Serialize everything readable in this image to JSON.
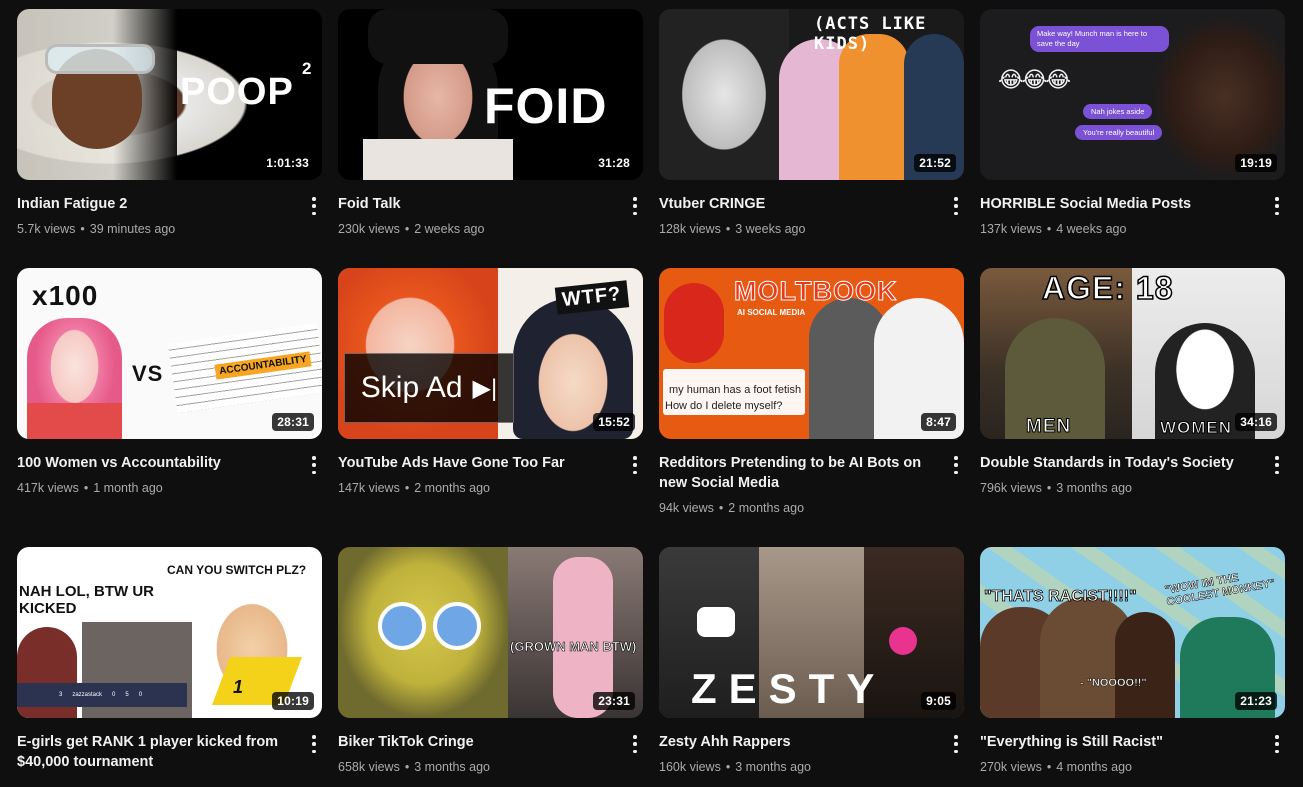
{
  "colors": {
    "background": "#0f0f0f",
    "title": "#f1f1f1",
    "subtitle": "#aaaaaa"
  },
  "videos": [
    {
      "title": "Indian Fatigue 2",
      "views": "5.7k views",
      "age": "39 minutes ago",
      "duration": "1:01:33",
      "overlay": "POOP",
      "overlay_sup": "2"
    },
    {
      "title": "Foid Talk",
      "views": "230k views",
      "age": "2 weeks ago",
      "duration": "31:28",
      "overlay": "FOID"
    },
    {
      "title": "Vtuber CRINGE",
      "views": "128k views",
      "age": "3 weeks ago",
      "duration": "21:52",
      "overlay": "(ACTS LIKE KIDS)"
    },
    {
      "title": "HORRIBLE Social Media Posts",
      "views": "137k views",
      "age": "4 weeks ago",
      "duration": "19:19",
      "chat1": "Make way! Munch man is here to save the day",
      "chat2": "Nah jokes aside",
      "chat3": "You're really beautiful"
    },
    {
      "title": "100 Women vs Accountability",
      "views": "417k views",
      "age": "1 month ago",
      "duration": "28:31",
      "overlay": "x100",
      "overlay2": "VS",
      "overlay3": "ACCOUNTABILITY"
    },
    {
      "title": "YouTube Ads Have Gone Too Far",
      "views": "147k views",
      "age": "2 months ago",
      "duration": "15:52",
      "overlay": "WTF?",
      "skip": "Skip Ad"
    },
    {
      "title": "Redditors Pretending to be AI Bots on new Social Media",
      "views": "94k views",
      "age": "2 months ago",
      "duration": "8:47",
      "overlay": "MOLTBOOK",
      "overlay2": "AI SOCIAL MEDIA",
      "overlay3": "my human has a foot fetish",
      "overlay4": "How do I delete myself?"
    },
    {
      "title": "Double Standards in Today's Society",
      "views": "796k views",
      "age": "3 months ago",
      "duration": "34:16",
      "overlay": "AGE: 18",
      "overlay2": "MEN",
      "overlay3": "WOMEN"
    },
    {
      "title": "E-girls get RANK 1 player kicked from $40,000 tournament",
      "views": "",
      "age": "",
      "duration": "10:19",
      "overlay": "NAH LOL, BTW UR KICKED",
      "overlay2": "CAN YOU SWITCH PLZ?",
      "overlay3": "1"
    },
    {
      "title": "Biker TikTok Cringe",
      "views": "658k views",
      "age": "3 months ago",
      "duration": "23:31",
      "overlay": "(GROWN MAN BTW)"
    },
    {
      "title": "Zesty Ahh Rappers",
      "views": "160k views",
      "age": "3 months ago",
      "duration": "9:05",
      "overlay": "ZESTY"
    },
    {
      "title": "\"Everything is Still Racist\"",
      "views": "270k views",
      "age": "4 months ago",
      "duration": "21:23",
      "overlay": "\"THATS RACIST!!!!\"",
      "overlay2": "\"WOW IM THE COOLEST MONKEY\"",
      "overlay3": "- \"NOOOO!!\""
    }
  ]
}
